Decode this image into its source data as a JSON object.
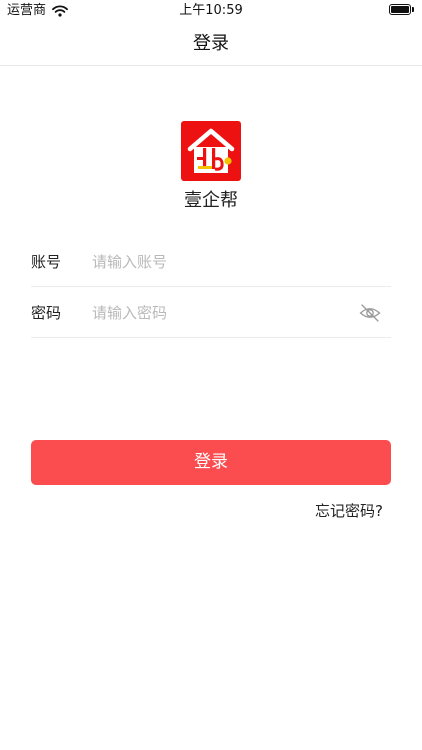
{
  "status_bar": {
    "carrier": "运营商",
    "time": "上午10:59",
    "wifi_icon": "wifi-icon",
    "battery_icon": "battery-icon"
  },
  "nav": {
    "title": "登录"
  },
  "app": {
    "logo_icon": "app-logo-icon",
    "name": "壹企帮",
    "brand_color": "#ff0000",
    "logo_accent_color": "#f5c400"
  },
  "form": {
    "account": {
      "label": "账号",
      "placeholder": "请输入账号",
      "value": ""
    },
    "password": {
      "label": "密码",
      "placeholder": "请输入密码",
      "value": "",
      "toggle_icon": "eye-off-icon"
    }
  },
  "actions": {
    "login_label": "登录",
    "login_color": "#fb4d4f",
    "forgot_label": "忘记密码?"
  }
}
